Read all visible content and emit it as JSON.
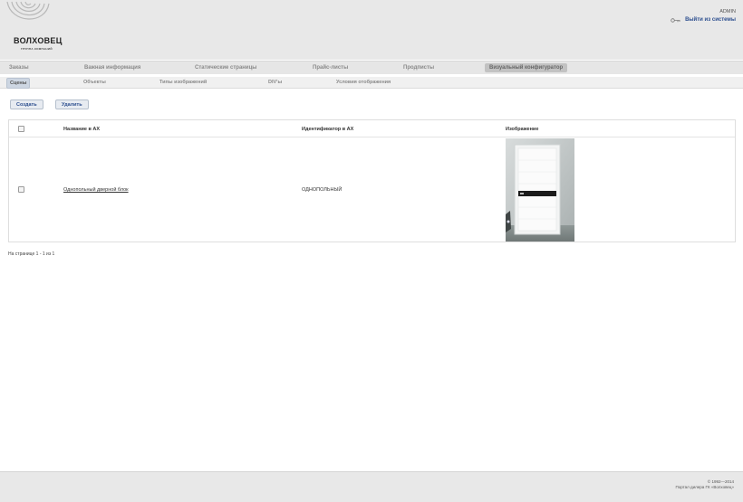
{
  "header": {
    "logo_text": "ВОЛХОВЕЦ",
    "logo_sub": "ГРУППА КОМПАНИЙ",
    "user_name": "ADMIN",
    "logout": "Выйти из системы"
  },
  "nav_primary": [
    {
      "label": "Заказы",
      "active": false
    },
    {
      "label": "Важная информация",
      "active": false
    },
    {
      "label": "Статические страницы",
      "active": false
    },
    {
      "label": "Прайс-листы",
      "active": false
    },
    {
      "label": "Продписты",
      "active": false
    },
    {
      "label": "Визуальный конфигуратор",
      "active": true
    }
  ],
  "nav_secondary": [
    {
      "label": "Сцены",
      "active": true
    },
    {
      "label": "Объекты",
      "active": false
    },
    {
      "label": "Типы изображений",
      "active": false
    },
    {
      "label": "DIV'ы",
      "active": false
    },
    {
      "label": "Условия отображения",
      "active": false
    }
  ],
  "toolbar": {
    "create": "Создать",
    "delete": "Удалить"
  },
  "table": {
    "columns": [
      "Название в АХ",
      "Идентификатор в АХ",
      "Изображение"
    ],
    "rows": [
      {
        "name": "Однопольный дверной блок",
        "identifier": "ОДНОПОЛЬНЫЙ",
        "checked": false
      }
    ]
  },
  "pager": "На странице 1 - 1 из 1",
  "footer": {
    "copyright": "© 1992—2014",
    "portal": "Портал дилера ГК «Волховец»"
  },
  "colors": {
    "link": "#2d4f8f",
    "header_bg": "#e8e8e8",
    "active_tab": "#c2c2c2"
  }
}
